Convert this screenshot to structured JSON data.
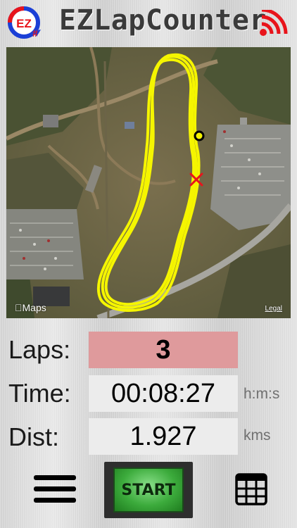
{
  "header": {
    "logo_text": "EZ",
    "title": "EZLapCounter"
  },
  "map": {
    "attribution": "Maps",
    "legal_label": "Legal"
  },
  "stats": {
    "laps_label": "Laps:",
    "laps_value": "3",
    "time_label": "Time:",
    "time_value": "00:08:27",
    "time_unit": "h:m:s",
    "dist_label": "Dist:",
    "dist_value": "1.927",
    "dist_unit": "kms"
  },
  "toolbar": {
    "start_label": "START"
  },
  "colors": {
    "track": "#f5f500",
    "laps_bg": "#df9a9c",
    "start_green": "#3cab3c",
    "signal_red": "#e8141b",
    "logo_blue": "#1b3fd6"
  },
  "icons": {
    "menu": "hamburger-icon",
    "grid": "table-grid-icon",
    "signal": "wireless-signal-icon"
  }
}
